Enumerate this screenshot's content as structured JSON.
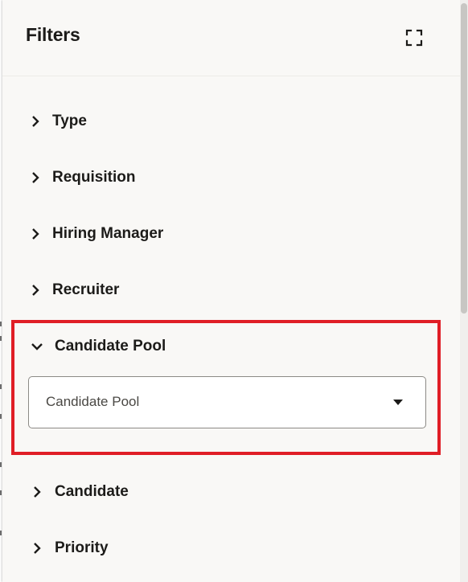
{
  "panel": {
    "title": "Filters",
    "expand_icon": "expand-fullscreen-icon"
  },
  "filters": [
    {
      "label": "Type",
      "expanded": false
    },
    {
      "label": "Requisition",
      "expanded": false
    },
    {
      "label": "Hiring Manager",
      "expanded": false
    },
    {
      "label": "Recruiter",
      "expanded": false
    },
    {
      "label": "Candidate Pool",
      "expanded": true
    },
    {
      "label": "Candidate",
      "expanded": false
    },
    {
      "label": "Priority",
      "expanded": false
    }
  ],
  "candidate_pool_select": {
    "placeholder": "Candidate Pool",
    "caret_icon": "caret-down-icon"
  },
  "colors": {
    "highlight": "#e01e26",
    "panel_bg": "#f9f8f6",
    "text": "#1c1b19"
  }
}
